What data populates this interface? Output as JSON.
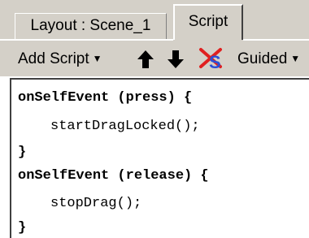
{
  "tabs": [
    {
      "label": "Layout : Scene_1",
      "active": false
    },
    {
      "label": "Script",
      "active": true
    }
  ],
  "toolbar": {
    "add_script_label": "Add Script",
    "move_up_icon": "arrow-up-icon",
    "move_down_icon": "arrow-down-icon",
    "delete_icon": "delete-script-icon",
    "guided_label": "Guided"
  },
  "code": {
    "line1": "onSelfEvent (press) {",
    "line2": "startDragLocked();",
    "line3": "}",
    "line4": "onSelfEvent (release) {",
    "line5": "stopDrag();",
    "line6": "}"
  },
  "colors": {
    "chrome": "#d4d0c8",
    "delete_icon_red": "#e02020",
    "delete_icon_blue": "#2a4fd8"
  }
}
